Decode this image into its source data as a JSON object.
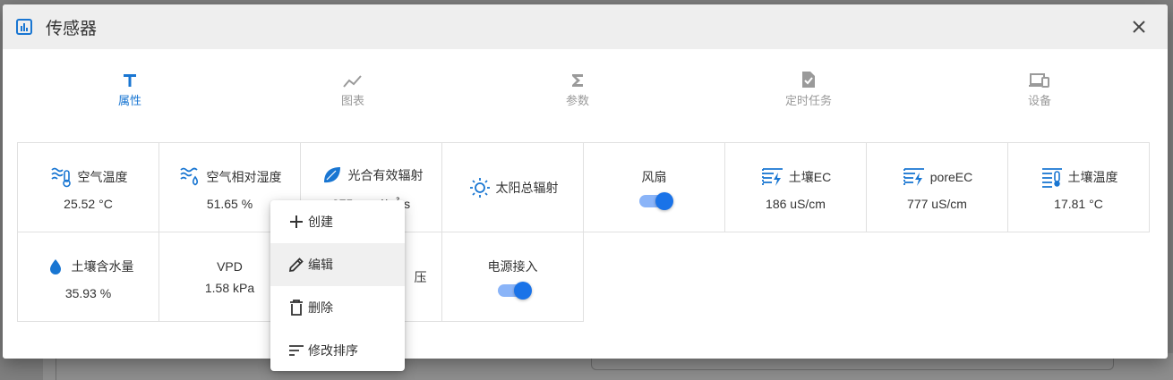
{
  "dialog": {
    "title": "传感器",
    "close_icon": "close-icon"
  },
  "tabs": [
    {
      "label": "属性",
      "icon": "text-icon",
      "active": true
    },
    {
      "label": "图表",
      "icon": "chart-line-icon",
      "active": false
    },
    {
      "label": "参数",
      "icon": "sigma-icon",
      "active": false
    },
    {
      "label": "定时任务",
      "icon": "file-check-icon",
      "active": false
    },
    {
      "label": "设备",
      "icon": "devices-icon",
      "active": false
    }
  ],
  "sensors": [
    {
      "name": "空气温度",
      "value": "25.52 °C",
      "icon": "air-temperature-icon"
    },
    {
      "name": "空气相对湿度",
      "value": "51.65 %",
      "icon": "air-humidity-icon"
    },
    {
      "name": "光合有效辐射",
      "value": "375 umol/㎡·s",
      "icon": "leaf-icon"
    },
    {
      "name": "太阳总辐射",
      "value": "",
      "icon": "sun-icon"
    },
    {
      "name": "风扇",
      "value": "",
      "icon": "",
      "toggle": true
    },
    {
      "name": "土壤EC",
      "value": "186 uS/cm",
      "icon": "soil-ec-icon"
    },
    {
      "name": "poreEC",
      "value": "777 uS/cm",
      "icon": "pore-ec-icon"
    },
    {
      "name": "土壤温度",
      "value": "17.81 °C",
      "icon": "soil-temperature-icon"
    },
    {
      "name": "土壤含水量",
      "value": "35.93 %",
      "icon": "water-drop-icon"
    },
    {
      "name": "VPD",
      "value": "1.58 kPa",
      "icon": ""
    },
    {
      "name": "压",
      "value": "",
      "icon": ""
    },
    {
      "name": "电源接入",
      "value": "",
      "icon": "",
      "toggle": true
    }
  ],
  "context_menu": [
    {
      "label": "创建",
      "icon": "plus-icon"
    },
    {
      "label": "编辑",
      "icon": "pencil-icon"
    },
    {
      "label": "删除",
      "icon": "trash-icon"
    },
    {
      "label": "修改排序",
      "icon": "sort-icon"
    }
  ],
  "colors": {
    "accent": "#1976d2",
    "toggle_track": "#8ab4f8",
    "toggle_knob": "#1a73e8"
  }
}
